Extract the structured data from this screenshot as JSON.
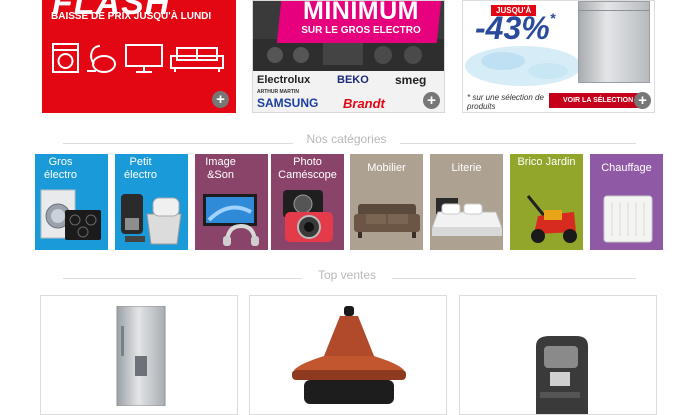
{
  "banners": {
    "flash": {
      "title": "FLASH",
      "subtitle": "BAISSE DE PRIX JUSQU'À LUNDI",
      "icons": [
        "washing-machine-icon",
        "vacuum-icon",
        "tv-icon",
        "sofa-icon"
      ]
    },
    "minimum": {
      "title": "MINIMUM",
      "subtitle": "SUR LE GROS ELECTRO",
      "brands": [
        "Electrolux",
        "BEKO",
        "smeg",
        "ARTHUR MARTIN",
        "SAMSUNG",
        "Brandt"
      ]
    },
    "promo": {
      "badge": "JUSQU'À",
      "discount": "-43%",
      "asterisk": "*",
      "note": "* sur une sélection de produits",
      "cta": "VOIR LA SÉLECTION"
    },
    "more_icon": "+"
  },
  "categories_section": {
    "title": "Nos catégories",
    "items": [
      {
        "label": "Gros électro",
        "color": "#1a9ad9"
      },
      {
        "label": "Petit électro",
        "color": "#1a9ad9"
      },
      {
        "label": "Image &Son",
        "color": "#8a4469"
      },
      {
        "label": "Photo Caméscope",
        "color": "#8a4469"
      },
      {
        "label": "Mobilier",
        "color": "#ada291"
      },
      {
        "label": "Literie",
        "color": "#ada291"
      },
      {
        "label": "Brico Jardin",
        "color": "#92a62b"
      },
      {
        "label": "Chauffage",
        "color": "#8f59a6"
      }
    ]
  },
  "top_section": {
    "title": "Top ventes",
    "products": [
      "fridge-freezer",
      "tajine-cooker",
      "espresso-machine"
    ]
  }
}
